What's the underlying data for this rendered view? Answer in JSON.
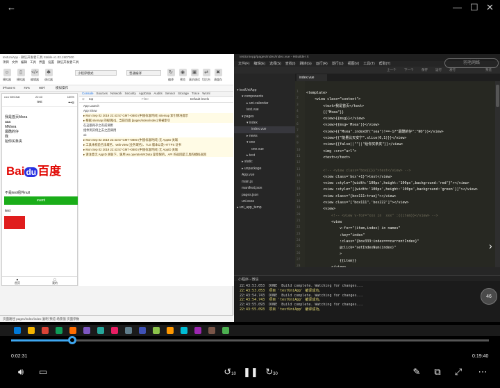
{
  "wechat": {
    "title": "testUniApp - 微信开发者工具 Stable v1.02.1907300",
    "menu": [
      "项目",
      "文件",
      "编辑",
      "工具",
      "界面",
      "设置",
      "微信开发者工具"
    ],
    "toolbar": [
      "模拟器",
      "编辑器",
      "调试器"
    ],
    "toolbar_right": [
      "编译",
      "预览",
      "真机调试",
      "切后台",
      "清缓存",
      "上传",
      "版本管理",
      "详情"
    ],
    "mode": "小程序模式",
    "compile_mode": "普通编译",
    "device": "iPhone 6",
    "zoom": "75%",
    "network": "WiFi",
    "ops": "模拟操作",
    "phone": {
      "status_left": "••••• WeChat",
      "status_time": "22:43",
      "status_right": "100%",
      "nav_title": "test",
      "lines": [
        "我是首页Msea",
        "aaa",
        "MMsea",
        "最酷的仔",
        "我",
        "始你买条夹"
      ],
      "btn_label": "event",
      "pre_text": "不是test组件null",
      "test_label": "test",
      "tabbar": [
        "首页",
        "我的"
      ],
      "logo": {
        "left": "Bai",
        "mark": "du",
        "right": "百度"
      }
    },
    "console": {
      "tabs": [
        "Console",
        "Sources",
        "Network",
        "Security",
        "AppData",
        "Audits",
        "Sensor",
        "Storage",
        "Trace",
        "Wxml"
      ],
      "context": "top",
      "filter_placeholder": "Filter",
      "levels": "Default levels",
      "logs": [
        "App Launch",
        "App Show",
        "▸ Mon Sep 02 2019 22:43:57 GMT+0800 (中国标准时间) sitemap 索引情况提示",
        "▸ 根据 sitemap 的规则[0]，当前页面 [pages/index/index] 将被索引",
        "在这都再存之有前调用",
        "组件到实例上去之后调用",
        "ok",
        "▸ Mon Sep 02 2019 22:43:57 GMT+0800 (中国标准时间) 无 AppID 关联",
        "▸ 工具未校验合法域名、web-view (业务域名)、TLS 版本以及 HTTPS 证书",
        "▸ Mon Sep 02 2019 22:43:57 GMT+0800 (中国标准时间) 无 AppID 关联",
        "▸ 请注意无 AppID 关联下，调用 wx.operateWXData 是受限的，API 的返回是工具的模拟返回"
      ]
    },
    "footer": [
      "页面路径",
      "pages/index/index",
      "复制",
      "预览",
      "场景值",
      "页面参数"
    ]
  },
  "hbuilder": {
    "title": "testUniApp/pages/index/index.vue - HBuilder X",
    "menu": [
      "文件(F)",
      "编辑(E)",
      "选择(S)",
      "查找(I)",
      "跳转(G)",
      "运行(R)",
      "发行(U)",
      "视图(V)",
      "工具(T)",
      "帮助(Y)"
    ],
    "toolbar": [
      "上一个",
      "下一个",
      "保存",
      "运行",
      "发行",
      "预览"
    ],
    "tab": "index.vue",
    "tree": [
      {
        "label": "testUniApp",
        "indent": 0,
        "arrow": "▾"
      },
      {
        "label": "components",
        "indent": 1,
        "arrow": "▾"
      },
      {
        "label": "uni-calendar",
        "indent": 2,
        "arrow": "▸"
      },
      {
        "label": "test.vue",
        "indent": 2,
        "arrow": ""
      },
      {
        "label": "pages",
        "indent": 1,
        "arrow": "▾"
      },
      {
        "label": "index",
        "indent": 2,
        "arrow": "▾"
      },
      {
        "label": "index.vue",
        "indent": 3,
        "arrow": ""
      },
      {
        "label": "news",
        "indent": 2,
        "arrow": "▸"
      },
      {
        "label": "one",
        "indent": 2,
        "arrow": "▾"
      },
      {
        "label": "one.vue",
        "indent": 3,
        "arrow": ""
      },
      {
        "label": "test",
        "indent": 2,
        "arrow": "▸"
      },
      {
        "label": "static",
        "indent": 1,
        "arrow": "▸"
      },
      {
        "label": "unpackage",
        "indent": 1,
        "arrow": "▸"
      },
      {
        "label": "App.vue",
        "indent": 1,
        "arrow": ""
      },
      {
        "label": "main.js",
        "indent": 1,
        "arrow": ""
      },
      {
        "label": "manifest.json",
        "indent": 1,
        "arrow": ""
      },
      {
        "label": "pages.json",
        "indent": 1,
        "arrow": ""
      },
      {
        "label": "uni.scss",
        "indent": 1,
        "arrow": ""
      },
      {
        "label": "uni_app_temp",
        "indent": 0,
        "arrow": "▸"
      }
    ],
    "code": [
      "<template>",
      "    <view class=\"content\">",
      "        <text>我是首页</text>",
      "        {{\"Msea\"}}",
      "        <view>{{msg}}</view>",
      "        <view>{{msg+'Msea'}}</view>",
      "        <view>{{\"Msea\".indexOf(\"sea\")!==-1?\"最酷的仔\":\"NO\"}}</view>",
      "        <view>{{\"能量比天安宁\".slice(0,1)}}</view>",
      "        <view>{{false||\"\"||\"给你买条夹\"}}</view>",
      "        <img :src=\"url\">",
      "        <text></text>",
      "",
      "        <!-- <view class=\"box{{}}\">test</view> -->",
      "        <view class='box'+1}\">test</view>",
      "        <view :style=\"{width:'100px',height:'100px',background:'red'}\"></view>",
      "        <view :style=\"[{width:'100px',height:'100px',background:'green'}]\"></view>",
      "        <view class=\"{box111:true}\"></view>",
      "        <view class=\"[\"box111\",'box222']\"></view>",
      "        <view>",
      "            <!-- <view v-for=\"xxx in  xxx\" :{{item}}</view> -->",
      "            <view",
      "                v-for=\"(item,index) in names\"",
      "                :key=\"index\"",
      "                :class=\"{box333:index===currentIndex}\"",
      "                @click=\"setIndexNum(index)\"",
      "                >",
      "                {{item}}",
      "            </view>",
      "        </view>",
      "        <view :class=\"[{box111:true},'box222']\"></view>",
      "    </view>",
      "</template>"
    ],
    "terminal_title": "小程序 - 微信",
    "terminal": [
      {
        "time": "22:43:53.053",
        "text": "DONE  Build complete. Watching for changes..."
      },
      {
        "time": "22:43:53.053",
        "text": "项目 'testUniApp' 编译成功。"
      },
      {
        "time": "22:43:54.743",
        "text": "DONE  Build complete. Watching for changes..."
      },
      {
        "time": "22:43:54.743",
        "text": "项目 'testUniApp' 编译成功。"
      },
      {
        "time": "22:43:55.093",
        "text": "DONE  Build complete. Watching for changes..."
      },
      {
        "time": "22:43:55.093",
        "text": "项目 'testUniApp' 编译成功。"
      }
    ]
  },
  "overlay": {
    "badge": "46",
    "watermark": "羽毛网络"
  },
  "player": {
    "current": "0:02:31",
    "total": "0:19:40",
    "progress": 0.128,
    "rewind": "10",
    "forward": "30"
  },
  "colors": {
    "accent": "#3ea7f0",
    "green": "#1aad19",
    "red": "#e01d1d",
    "baidu_red": "#e10601",
    "baidu_blue": "#2932e1"
  }
}
